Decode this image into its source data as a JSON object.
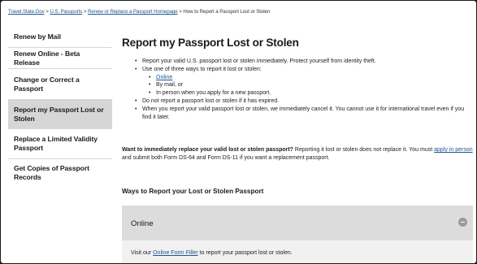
{
  "breadcrumb": {
    "items": [
      "Travel.State.Gov",
      "U.S. Passports",
      "Renew or Replace a Passport Homepage",
      "How to Report a Passport Lost or Stolen"
    ],
    "separator": ">"
  },
  "sidebar": {
    "items": [
      {
        "label": "Renew by Mail"
      },
      {
        "label": "Renew Online - Beta Release"
      },
      {
        "label": "Change or Correct a Passport"
      },
      {
        "label": "Report my Passport Lost or Stolen"
      },
      {
        "label": "Replace a Limited Validity Passport"
      },
      {
        "label": "Get Copies of Passport Records"
      }
    ]
  },
  "main": {
    "title": "Report my Passport Lost or Stolen",
    "bullets": {
      "b1": "Report your valid U.S. passport lost or stolen immediately. Protect yourself from identity theft.",
      "b2": "Use one of three ways to report it lost or stolen:",
      "sub1": "Online",
      "sub2": "By mail, or",
      "sub3": "In person when you apply for a new passport.",
      "b3": "Do not report a passport lost or stolen if it has expired.",
      "b4": "When you report your valid passport lost or stolen, we immediately cancel it. You cannot use it for international travel even if you find it later."
    },
    "para": {
      "bold": "Want to immediately replace your valid lost or stolen passport?",
      "text1": " Reporting it lost or stolen does not replace it. You must ",
      "link": "apply in person",
      "text2": " and submit both Form DS-64 and Form DS-11 if you want a replacement passport."
    },
    "section_heading": "Ways to Report your Lost or Stolen Passport",
    "accordion": {
      "title": "Online",
      "text_before": "Visit our ",
      "link": "Online Form Filler",
      "text_after": " to report your passport lost or stolen."
    }
  },
  "colors": {
    "link": "#205493",
    "sidebar_active_bg": "#d6d6d6",
    "accordion_head_bg": "#dcdcdc",
    "accordion_body_bg": "#f1f1f1"
  },
  "icons": {
    "accordion_toggle": "minus-circle-icon"
  }
}
